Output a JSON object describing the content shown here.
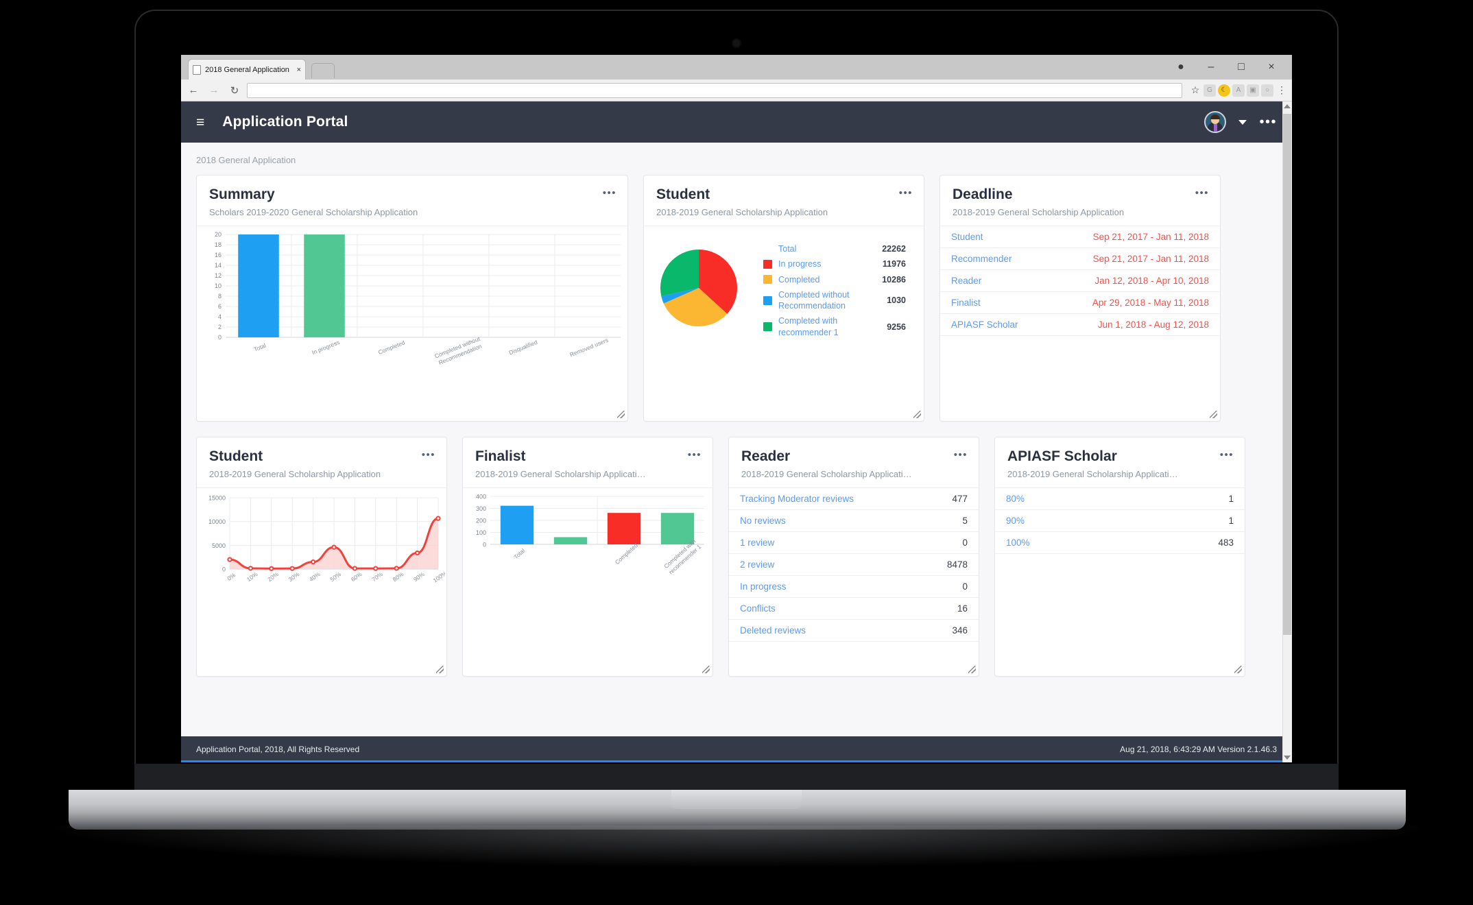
{
  "browser": {
    "tab_title": "2018 General Application",
    "tab_close": "×",
    "back_icon": "←",
    "forward_icon": "→",
    "reload_icon": "↻",
    "url_value": "",
    "url_placeholder": "",
    "window_profile": "●",
    "window_minimize": "–",
    "window_maximize": "□",
    "window_close": "×",
    "extensions": [
      "☆",
      "G",
      "☾",
      "A",
      "☒",
      "○",
      "⋮"
    ]
  },
  "appbar": {
    "menu_icon": "≡",
    "title": "Application Portal",
    "overflow_icon": "•••"
  },
  "breadcrumb": "2018 General Application",
  "cards": {
    "summary": {
      "title": "Summary",
      "subtitle": "Scholars 2019-2020 General Scholarship Application",
      "dots": "•••"
    },
    "student_pie": {
      "title": "Student",
      "subtitle": "2018-2019 General Scholarship Application",
      "dots": "•••",
      "legend": [
        {
          "label": "Total",
          "value": "22262",
          "color": ""
        },
        {
          "label": "In progress",
          "value": "11976",
          "color": "#f92d28"
        },
        {
          "label": "Completed",
          "value": "10286",
          "color": "#fbb731"
        },
        {
          "label": "Completed without Recommendation",
          "value": "1030",
          "color": "#1e9ff2"
        },
        {
          "label": "Completed with recommender 1",
          "value": "9256",
          "color": "#0ab86b"
        }
      ]
    },
    "deadline": {
      "title": "Deadline",
      "subtitle": "2018-2019 General Scholarship Application",
      "dots": "•••",
      "rows": [
        {
          "label": "Student",
          "value": "Sep 21, 2017 - Jan 11, 2018"
        },
        {
          "label": "Recommender",
          "value": "Sep 21, 2017 - Jan 11, 2018"
        },
        {
          "label": "Reader",
          "value": "Jan 12, 2018 - Apr 10, 2018"
        },
        {
          "label": "Finalist",
          "value": "Apr 29, 2018 - May 11, 2018"
        },
        {
          "label": "APIASF Scholar",
          "value": "Jun 1, 2018 - Aug 12, 2018"
        }
      ]
    },
    "student_area": {
      "title": "Student",
      "subtitle": "2018-2019 General Scholarship Application",
      "dots": "•••"
    },
    "finalist": {
      "title": "Finalist",
      "subtitle": "2018-2019 General Scholarship Applicati…",
      "dots": "•••"
    },
    "reader": {
      "title": "Reader",
      "subtitle": "2018-2019 General Scholarship Applicati…",
      "dots": "•••",
      "rows": [
        {
          "label": "Tracking Moderator reviews",
          "value": "477"
        },
        {
          "label": "No reviews",
          "value": "5"
        },
        {
          "label": "1 review",
          "value": "0"
        },
        {
          "label": "2 review",
          "value": "8478"
        },
        {
          "label": "In progress",
          "value": "0"
        },
        {
          "label": "Conflicts",
          "value": "16"
        },
        {
          "label": "Deleted reviews",
          "value": "346"
        }
      ]
    },
    "apiasf": {
      "title": "APIASF Scholar",
      "subtitle": "2018-2019 General Scholarship Applicati…",
      "dots": "•••",
      "rows": [
        {
          "label": "80%",
          "value": "1"
        },
        {
          "label": "90%",
          "value": "1"
        },
        {
          "label": "100%",
          "value": "483"
        }
      ]
    }
  },
  "footer": {
    "left": "Application Portal, 2018, All Rights Reserved",
    "right": "Aug 21, 2018, 6:43:29 AM Version 2.1.46.3"
  },
  "chart_data": [
    {
      "id": "summary_bar",
      "type": "bar",
      "title": "Summary",
      "categories": [
        "Total",
        "In progress",
        "Completed",
        "Completed without Recommendation",
        "Disqualified",
        "Removed users"
      ],
      "values": [
        20,
        20,
        0,
        0,
        0,
        0
      ],
      "colors": [
        "#1e9ff2",
        "#51c793",
        "#f92d28",
        "#51c793",
        "#fbb731",
        "#9b59b6"
      ],
      "ylim": [
        0,
        20
      ],
      "yticks": [
        0,
        2,
        4,
        6,
        8,
        10,
        12,
        14,
        16,
        18,
        20
      ],
      "xlabel": "",
      "ylabel": "",
      "grid": true,
      "legend": "none"
    },
    {
      "id": "student_pie",
      "type": "pie",
      "title": "Student",
      "labels": [
        "In progress",
        "Completed",
        "Completed without Recommendation",
        "Completed with recommender 1"
      ],
      "values": [
        11976,
        10286,
        1030,
        9256
      ],
      "colors": [
        "#f92d28",
        "#fbb731",
        "#1e9ff2",
        "#0ab86b"
      ],
      "total": 22262,
      "legend": "right"
    },
    {
      "id": "student_area",
      "type": "area",
      "title": "Student",
      "x": [
        "0%",
        "10%",
        "20%",
        "30%",
        "40%",
        "50%",
        "60%",
        "70%",
        "80%",
        "90%",
        "100%"
      ],
      "values": [
        2000,
        150,
        100,
        120,
        1500,
        4600,
        130,
        120,
        150,
        3400,
        10650
      ],
      "color": "#f4403a",
      "fill": "#fbd0ce",
      "ylim": [
        0,
        15000
      ],
      "yticks": [
        0,
        5000,
        10000,
        15000
      ],
      "xlabel": "",
      "ylabel": "",
      "grid": true,
      "legend": "none"
    },
    {
      "id": "finalist_bar",
      "type": "bar",
      "title": "Finalist",
      "categories": [
        "Total",
        "",
        "Completed",
        "Completed with recommender 1"
      ],
      "values": [
        322,
        60,
        262,
        262
      ],
      "colors": [
        "#1e9ff2",
        "#51c793",
        "#f92d28",
        "#51c793"
      ],
      "ylim": [
        0,
        400
      ],
      "yticks": [
        0,
        100,
        200,
        300,
        400
      ],
      "xlabel": "",
      "ylabel": "",
      "grid": true,
      "legend": "none"
    }
  ]
}
